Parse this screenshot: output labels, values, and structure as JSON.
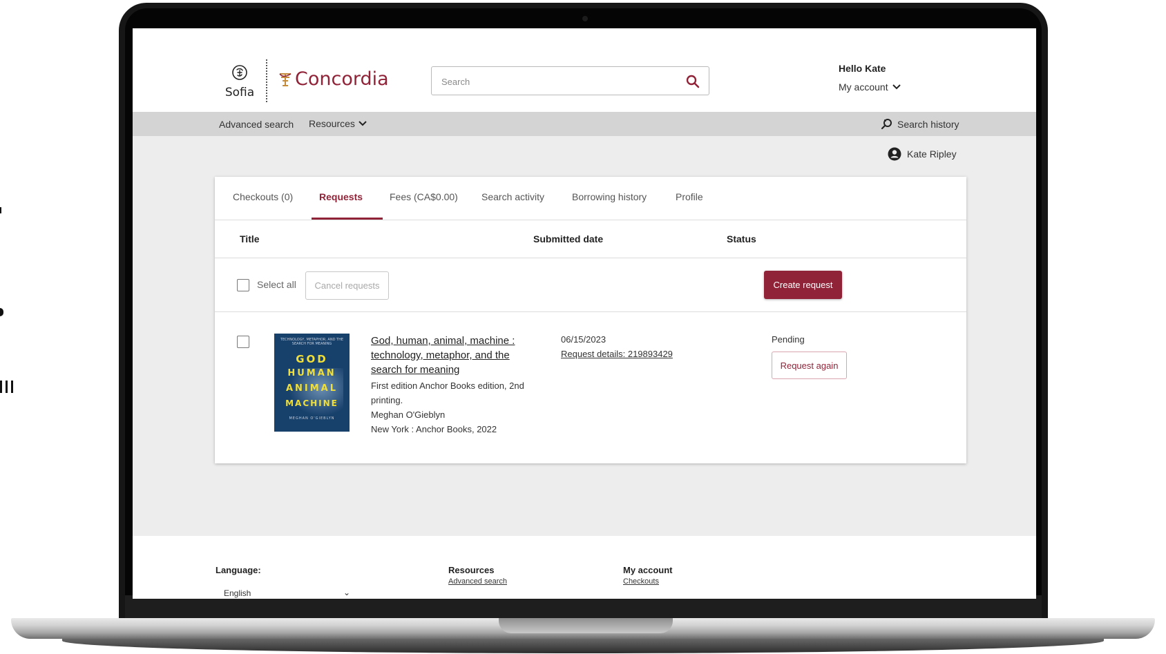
{
  "header": {
    "sofia_logo_text": "Sofia",
    "concordia_logo_text": "Concordia",
    "search_placeholder": "Search",
    "greeting": "Hello Kate",
    "my_account_label": "My account"
  },
  "nav": {
    "advanced_search": "Advanced search",
    "resources": "Resources",
    "search_history": "Search history"
  },
  "user": {
    "name": "Kate Ripley"
  },
  "tabs": [
    {
      "label": "Checkouts (0)"
    },
    {
      "label": "Requests",
      "active": true
    },
    {
      "label": "Fees (CA$0.00)"
    },
    {
      "label": "Search activity"
    },
    {
      "label": "Borrowing history"
    },
    {
      "label": "Profile"
    }
  ],
  "table": {
    "columns": [
      "Title",
      "Submitted date",
      "Status"
    ],
    "select_all_label": "Select all",
    "cancel_label": "Cancel requests",
    "create_label": "Create request",
    "rows": [
      {
        "title": "God, human, animal, machine : technology, metaphor, and the search for meaning",
        "edition_line1": "First edition Anchor Books edition, 2nd",
        "edition_line2": "printing.",
        "author": "Meghan O'Gieblyn",
        "publisher": "New York : Anchor Books, 2022",
        "submitted_date": "06/15/2023",
        "request_details": "Request details: 219893429",
        "status": "Pending",
        "action_label": "Request again",
        "cover": {
          "top_text": "TECHNOLOGY, METAPHOR, AND THE SEARCH FOR MEANING",
          "word1": "GOD",
          "word2": "HUMAN",
          "word3": "ANIMAL",
          "word4": "MACHINE",
          "author": "MEGHAN O'GIEBLYN"
        }
      }
    ]
  },
  "footer": {
    "language_heading": "Language:",
    "language_value": "English",
    "resources_heading": "Resources",
    "resources_link": "Advanced search",
    "account_heading": "My account",
    "account_link": "Checkouts"
  },
  "colors": {
    "brand": "#912338",
    "nav_bg": "#d4d4d4",
    "page_bg": "#ededed"
  }
}
